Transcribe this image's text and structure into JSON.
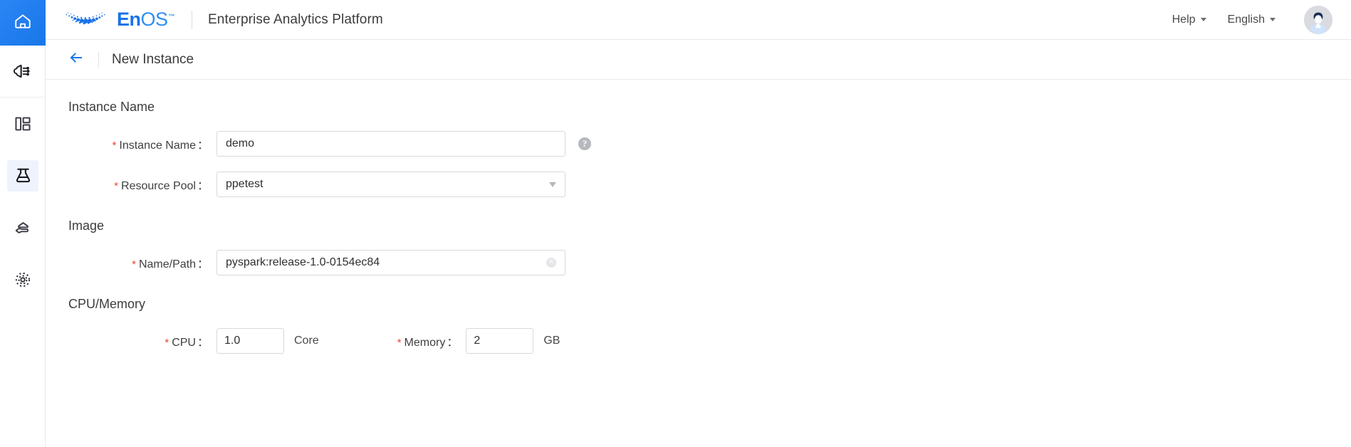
{
  "topbar": {
    "brand_en": "En",
    "brand_os": "OS",
    "brand_tm": "™",
    "platform_title": "Enterprise Analytics Platform",
    "help_label": "Help",
    "language_label": "English",
    "logo_icon": "enos-dots-logo",
    "avatar_icon": "user-avatar"
  },
  "rail": {
    "items": [
      {
        "name": "home",
        "icon": "home-icon",
        "active_home": true
      },
      {
        "name": "ai-models",
        "icon": "brain-network-icon"
      },
      {
        "name": "dashboards",
        "icon": "layout-panels-icon"
      },
      {
        "name": "lab-instances",
        "icon": "flask-icon",
        "selected": true
      },
      {
        "name": "data-service",
        "icon": "hand-hexagon-icon"
      },
      {
        "name": "settings",
        "icon": "dotted-gear-icon"
      }
    ]
  },
  "page": {
    "back_icon": "arrow-left-icon",
    "title": "New Instance"
  },
  "form": {
    "sections": {
      "instance_name": {
        "title": "Instance Name",
        "fields": {
          "instance_name": {
            "label": "Instance Name",
            "colon": "：",
            "value": "demo",
            "placeholder": "",
            "help_icon": "question-mark-icon"
          },
          "resource_pool": {
            "label": "Resource Pool",
            "colon": "：",
            "value": "ppetest",
            "placeholder": "",
            "caret_icon": "chevron-down-icon"
          }
        }
      },
      "image": {
        "title": "Image",
        "fields": {
          "name_path": {
            "label": "Name/Path",
            "colon": "：",
            "value": "pyspark:release-1.0-0154ec84",
            "placeholder": "",
            "clear_icon": "clear-circle-icon",
            "clear_glyph": "✕"
          }
        }
      },
      "cpu_memory": {
        "title": "CPU/Memory",
        "fields": {
          "cpu": {
            "label": "CPU",
            "colon": "：",
            "value": "1.0",
            "unit": "Core"
          },
          "memory": {
            "label": "Memory",
            "colon": "：",
            "value": "2",
            "unit": "GB"
          }
        }
      }
    },
    "required_marker": "*"
  },
  "colors": {
    "accent_blue": "#1877e8",
    "brand_blue": "#1b72e8",
    "required_red": "#f04134",
    "selected_bg": "#eef3fd"
  }
}
